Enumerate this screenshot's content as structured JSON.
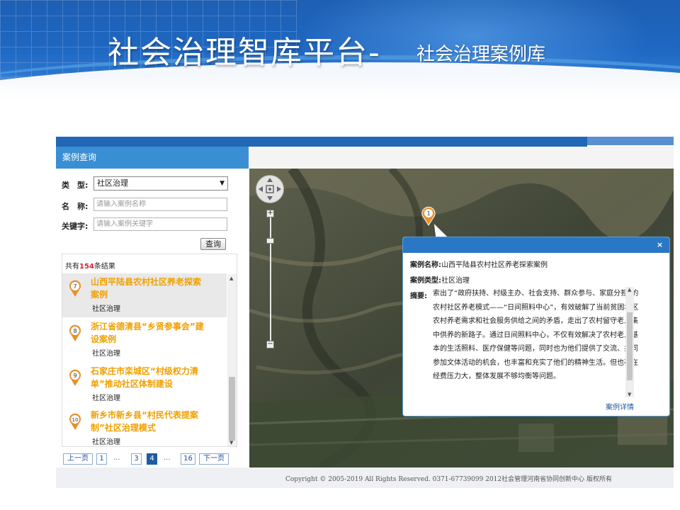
{
  "banner": {
    "title_main": "社会治理智库平台-",
    "title_sub": "社会治理案例库"
  },
  "panel": {
    "header": "案例查询",
    "form": {
      "type_label": "类　型:",
      "type_value": "社区治理",
      "name_label": "名　称:",
      "name_placeholder": "请输入案例名称",
      "keyword_label": "关键字:",
      "keyword_placeholder": "请输入案例关键字",
      "search_button": "查询"
    },
    "results": {
      "count_prefix": "共有",
      "count": "154",
      "count_suffix": "条结果",
      "items": [
        {
          "num": "7",
          "title": "山西平陆县农村社区养老探索案例",
          "category": "社区治理",
          "selected": true
        },
        {
          "num": "8",
          "title": "浙江省德清县“乡贤参事会”建设案例",
          "category": "社区治理",
          "selected": false
        },
        {
          "num": "9",
          "title": "石家庄市栾城区“村级权力清单”推动社区体制建设",
          "category": "社区治理",
          "selected": false
        },
        {
          "num": "10",
          "title": "新乡市新乡县“村民代表提案制”社区治理模式",
          "category": "社区治理",
          "selected": false
        }
      ]
    },
    "pager": {
      "prev": "上一页",
      "first": "1",
      "dots1": "...",
      "p3": "3",
      "p4": "4",
      "dots2": "...",
      "last": "16",
      "next": "下一页",
      "current": 4
    }
  },
  "map": {
    "marker_num": "1",
    "zoom_in": "+",
    "zoom_out": "−",
    "popup": {
      "name_label": "案例名称:",
      "name_value": "山西平陆县农村社区养老探索案例",
      "type_label": "案例类型:",
      "type_value": "社区治理",
      "abstract_label": "摘要:",
      "abstract": "索出了“政府扶持、村级主办、社会支持、群众参与、家庭分担”的农村社区养老模式——“日间照料中心”，有效破解了当前贫困地区农村养老需求和社会服务供给之间的矛盾，走出了农村留守老人集中供养的新路子。通过日间照料中心，不仅有效解决了农村老人基本的生活照料、医疗保健等问题，同时也为他们提供了交流、共同参加文体活动的机会，也丰富和充实了他们的精神生活。但也存在经费压力大，整体发展不够均衡等问题。",
      "detail_link": "案例详情",
      "close": "×"
    }
  },
  "footer": {
    "text": "Copyright © 2005-2019 All Rights Reserved. 0371-67739099 2012社会管理河南省协同创新中心 版权所有"
  },
  "colors": {
    "accent_blue": "#2a78c5",
    "result_title": "#f0a000",
    "count_red": "#d9232e",
    "pin_orange": "#e8912a"
  }
}
